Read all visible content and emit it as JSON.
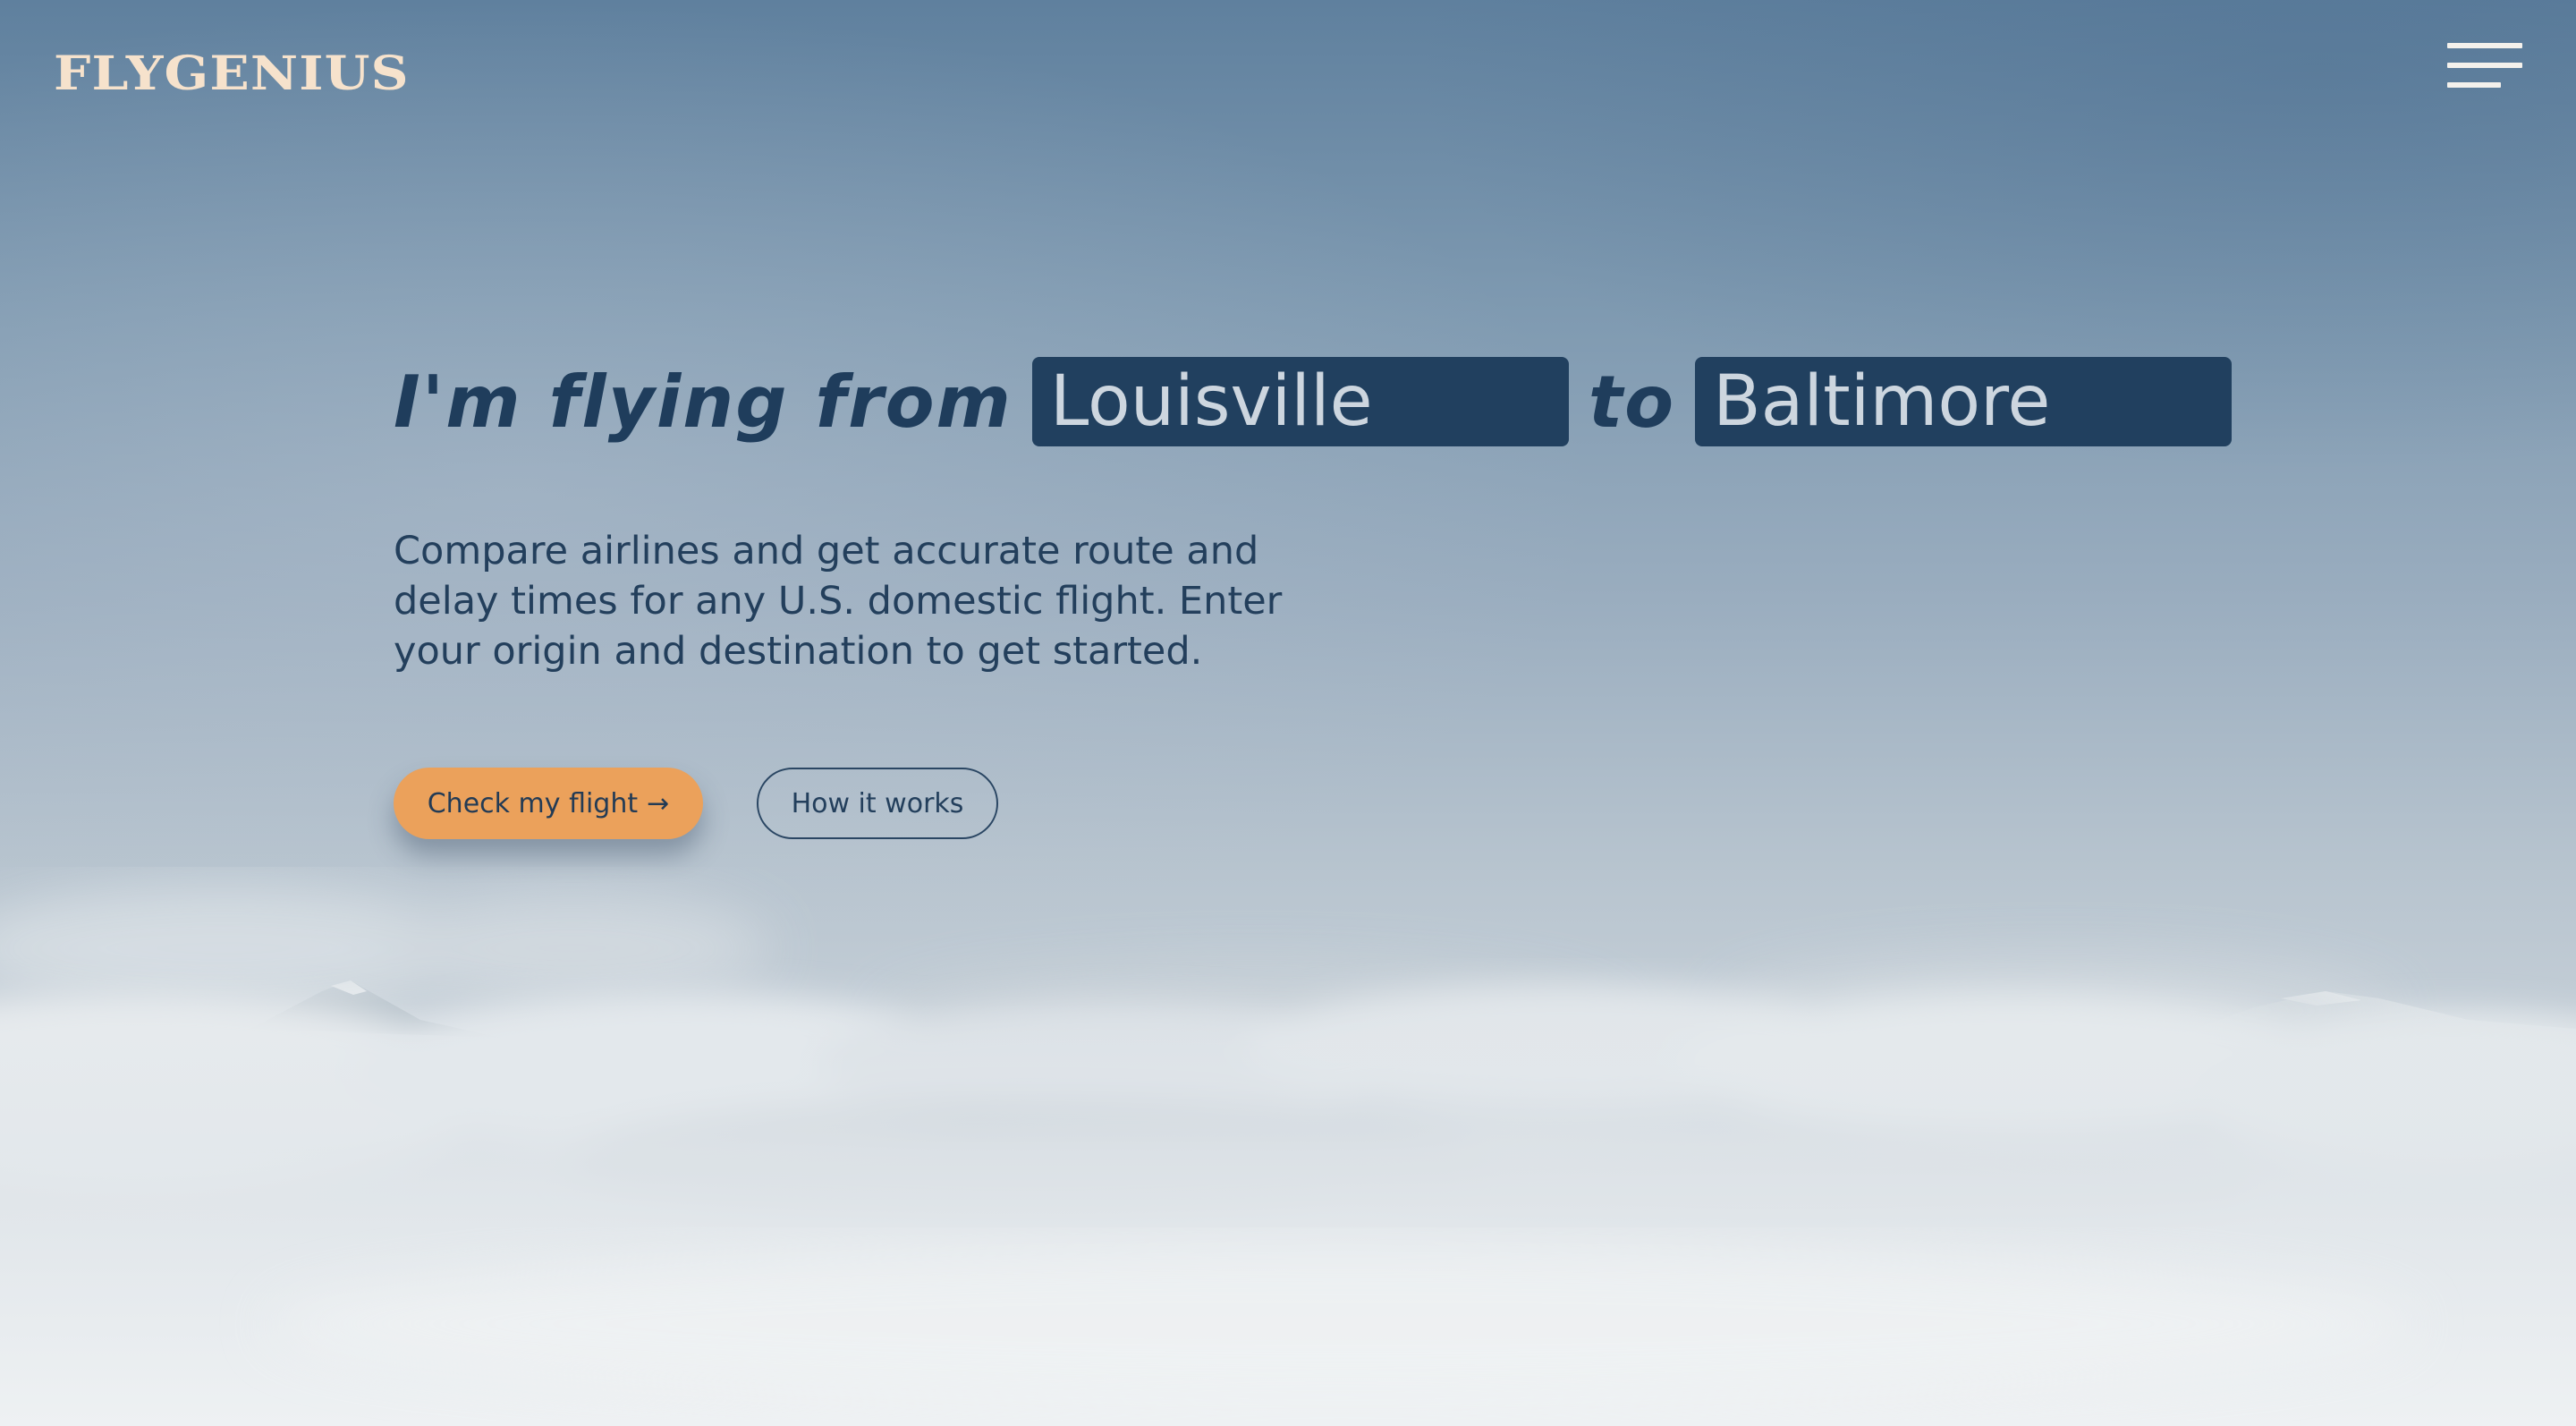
{
  "brand": {
    "logo_text": "FlyGenius"
  },
  "header": {
    "menu_icon": "hamburger-menu-icon"
  },
  "hero": {
    "prefix": "I'm flying from",
    "origin_value": "Louisville",
    "connector": "to",
    "destination_value": "Baltimore",
    "description": "Compare airlines and get accurate route and delay times for any U.S. domestic flight. Enter your origin and destination to get started."
  },
  "actions": {
    "primary_label": "Check my flight",
    "primary_arrow": "→",
    "secondary_label": "How it works"
  },
  "colors": {
    "accent": "#eba15b",
    "navy": "#21405f",
    "logo": "#f6e2cc"
  }
}
